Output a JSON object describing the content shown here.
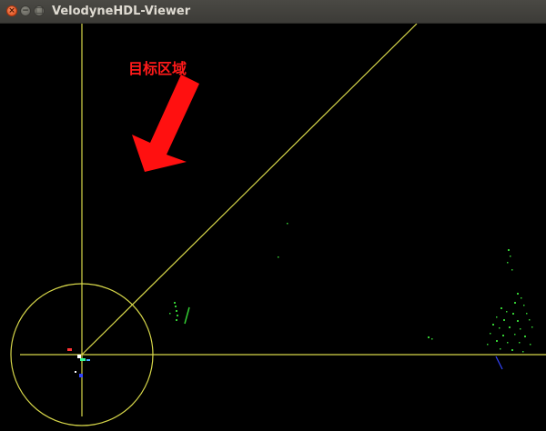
{
  "window": {
    "title": "VelodyneHDL-Viewer",
    "controls": [
      {
        "name": "close",
        "glyph": "×"
      },
      {
        "name": "minimize",
        "glyph": "−"
      },
      {
        "name": "maximize",
        "glyph": "□"
      }
    ]
  },
  "viewport": {
    "background": "#000000",
    "annotation": {
      "label": "目标区域",
      "color": "#ff1a1a",
      "arrow": "red-arrow-pointing-down-left"
    },
    "overlay_color": "#d8d84a",
    "point_cloud_color": "#33cc33",
    "axis_colors": {
      "x": "#ff3333",
      "y": "#33ff99",
      "z": "#3344ff"
    }
  }
}
